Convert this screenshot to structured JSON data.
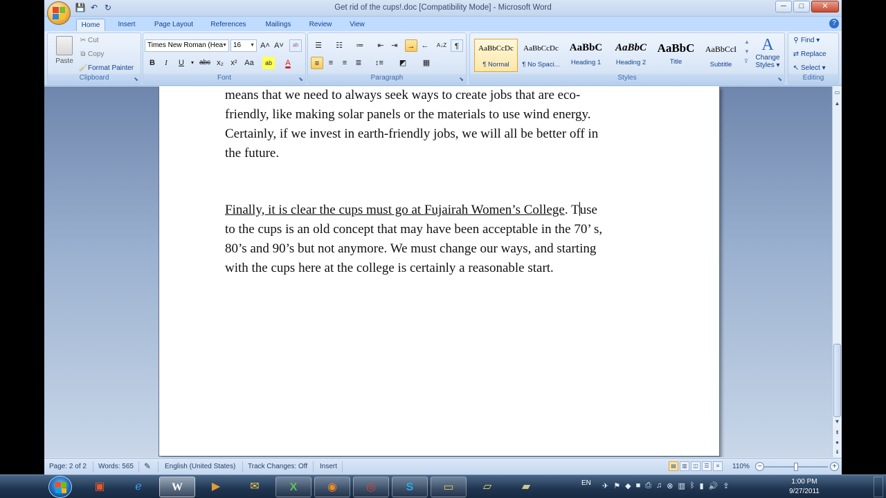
{
  "window": {
    "title": "Get rid of the cups!.doc [Compatibility Mode] - Microsoft Word",
    "controls": [
      "─",
      "□",
      "✕"
    ]
  },
  "qat": {
    "save": "💾",
    "undo": "↶",
    "redo": "↻"
  },
  "tabs": [
    "Home",
    "Insert",
    "Page Layout",
    "References",
    "Mailings",
    "Review",
    "View"
  ],
  "active_tab": "Home",
  "help_glyph": "?",
  "ribbon": {
    "clipboard": {
      "label": "Clipboard",
      "paste": "Paste",
      "cut": "Cut",
      "copy": "Copy",
      "format_painter": "Format Painter"
    },
    "font": {
      "label": "Font",
      "font_name": "Times New Roman (Hea",
      "font_size": "16",
      "grow": "A˄",
      "shrink": "A˅",
      "clear": "ᵃᵇ",
      "bold": "B",
      "italic": "I",
      "underline": "U",
      "strike": "abc",
      "subscript": "x₂",
      "superscript": "x²",
      "change_case": "Aa",
      "highlight": "ab",
      "font_color": "A"
    },
    "paragraph": {
      "label": "Paragraph",
      "show_marks": "¶",
      "sort": "A↓Z"
    },
    "styles": {
      "label": "Styles",
      "items": [
        {
          "sample": "AaBbCcDc",
          "name": "¶ Normal"
        },
        {
          "sample": "AaBbCcDc",
          "name": "¶ No Spaci..."
        },
        {
          "sample": "AaBbC",
          "name": "Heading 1"
        },
        {
          "sample": "AaBbC",
          "name": "Heading 2"
        },
        {
          "sample": "AaBbC",
          "name": "Title"
        },
        {
          "sample": "AaBbCcI",
          "name": "Subtitle"
        }
      ],
      "change_styles": "Change Styles",
      "change_styles_line1": "Change",
      "change_styles_line2": "Styles ▾"
    },
    "editing": {
      "label": "Editing",
      "find": "Find ▾",
      "replace": "Replace",
      "select": "Select ▾"
    }
  },
  "document": {
    "para1": [
      "means that we need to always seek ways to create jobs  that are  eco-",
      "friendly, like making solar panels or the materials to use wind energy.",
      "Certainly, if we invest in earth-friendly jobs, we will all be better off in",
      "the future."
    ],
    "para2_line1_underlined": "Finally, it is clear the cups must go at Fujairah Women’s College",
    "para2_line1_before_cursor": ".  T",
    "para2_line1_after_cursor": "use",
    "para2_rest": [
      "to the cups is an old concept that may have been acceptable in the 70’ s,",
      "80’s and  90’s but not anymore.  We must change our ways, and starting",
      "with the cups here at the college is certainly a reasonable start."
    ]
  },
  "statusbar": {
    "page": "Page: 2 of 2",
    "words": "Words: 565",
    "language": "English (United States)",
    "track_changes": "Track Changes: Off",
    "mode": "Insert",
    "zoom": "110%"
  },
  "taskbar": {
    "language": "EN",
    "time": "1:00 PM",
    "date": "9/27/2011"
  }
}
